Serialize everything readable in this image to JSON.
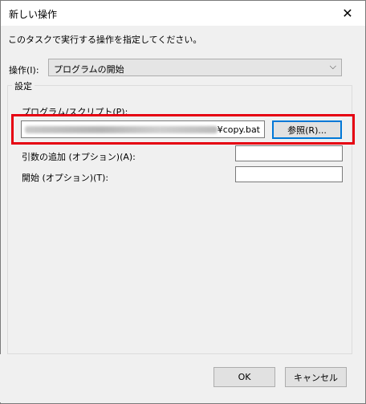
{
  "window": {
    "title": "新しい操作",
    "close_glyph": "✕"
  },
  "instruction": "このタスクで実行する操作を指定してください。",
  "operation": {
    "label": "操作(I):",
    "value": "プログラムの開始",
    "chevron": "⌵"
  },
  "settings": {
    "group_label": "設定",
    "program": {
      "label": "プログラム/スクリプト(P):",
      "value": "¥copy.bat",
      "browse_label": "参照(R)..."
    },
    "arguments": {
      "label": "引数の追加 (オプション)(A):",
      "value": ""
    },
    "start_in": {
      "label": "開始 (オプション)(T):",
      "value": ""
    }
  },
  "buttons": {
    "ok": "OK",
    "cancel": "キャンセル"
  },
  "colors": {
    "highlight": "#e60012",
    "focus": "#0078d7"
  }
}
